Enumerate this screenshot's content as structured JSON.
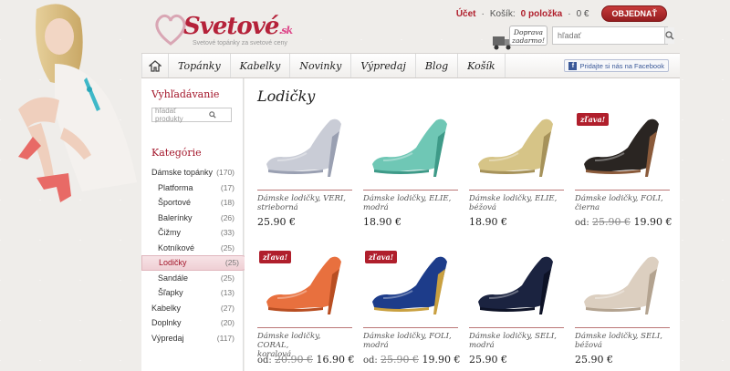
{
  "header": {
    "logo_text": "Svetové",
    "logo_suffix": ".sk",
    "tagline": "Svetové topánky za svetové ceny",
    "account_label": "Účet",
    "cart_label": "Košík:",
    "cart_count": "0 položka",
    "cart_total": "0 €",
    "order_button": "OBJEDNAŤ",
    "delivery_badge_line1": "Doprava",
    "delivery_badge_line2": "zadarmo!",
    "search_placeholder": "hľadať"
  },
  "nav": {
    "items": [
      "Topánky",
      "Kabelky",
      "Novinky",
      "Výpredaj",
      "Blog",
      "Košík"
    ],
    "facebook_label": "Pridajte si nás na Facebook"
  },
  "sidebar": {
    "search_title": "Vyhľadávanie",
    "search_placeholder": "hľadať produkty",
    "categories_title": "Kategórie",
    "categories": [
      {
        "label": "Dámske topánky",
        "count": "(170)",
        "sub": false,
        "active": false
      },
      {
        "label": "Platforma",
        "count": "(17)",
        "sub": true,
        "active": false
      },
      {
        "label": "Športové",
        "count": "(18)",
        "sub": true,
        "active": false
      },
      {
        "label": "Balerínky",
        "count": "(26)",
        "sub": true,
        "active": false
      },
      {
        "label": "Čižmy",
        "count": "(33)",
        "sub": true,
        "active": false
      },
      {
        "label": "Kotníkové",
        "count": "(25)",
        "sub": true,
        "active": false
      },
      {
        "label": "Lodičky",
        "count": "(25)",
        "sub": true,
        "active": true
      },
      {
        "label": "Sandále",
        "count": "(25)",
        "sub": true,
        "active": false
      },
      {
        "label": "Šľapky",
        "count": "(13)",
        "sub": true,
        "active": false
      },
      {
        "label": "Kabelky",
        "count": "(27)",
        "sub": false,
        "active": false
      },
      {
        "label": "Doplnky",
        "count": "(20)",
        "sub": false,
        "active": false
      },
      {
        "label": "Výpredaj",
        "count": "(117)",
        "sub": false,
        "active": false
      }
    ]
  },
  "main": {
    "title": "Lodičky",
    "sale_badge": "zľava!",
    "from_label": "od:",
    "products": [
      {
        "name_line1": "Dámske lodičky, VERI,",
        "name_line2": "strieborná",
        "price": "25.90 €",
        "old_price": "",
        "sale": false,
        "color": "#c9ccd6",
        "accent": "#9aa0b2"
      },
      {
        "name_line1": "Dámske lodičky, ELIE,",
        "name_line2": "modrá",
        "price": "18.90 €",
        "old_price": "",
        "sale": false,
        "color": "#6fc7b5",
        "accent": "#3e9a88"
      },
      {
        "name_line1": "Dámske lodičky, ELIE,",
        "name_line2": "béžová",
        "price": "18.90 €",
        "old_price": "",
        "sale": false,
        "color": "#d6c487",
        "accent": "#a6925a"
      },
      {
        "name_line1": "Dámske lodičky, FOLI,",
        "name_line2": "čierna",
        "price": "19.90 €",
        "old_price": "25.90 €",
        "sale": true,
        "color": "#2a2522",
        "accent": "#8a5a3a"
      },
      {
        "name_line1": "Dámske lodičky, CORAL,",
        "name_line2": "koralová",
        "price": "16.90 €",
        "old_price": "20.90 €",
        "sale": true,
        "color": "#e8703e",
        "accent": "#b84e22"
      },
      {
        "name_line1": "Dámske lodičky, FOLI,",
        "name_line2": "modrá",
        "price": "19.90 €",
        "old_price": "25.90 €",
        "sale": true,
        "color": "#1d3c8a",
        "accent": "#c9a040"
      },
      {
        "name_line1": "Dámske lodičky, SELI,",
        "name_line2": "modrá",
        "price": "25.90 €",
        "old_price": "",
        "sale": false,
        "color": "#1b2340",
        "accent": "#0d1226"
      },
      {
        "name_line1": "Dámske lodičky, SELI,",
        "name_line2": "béžová",
        "price": "25.90 €",
        "old_price": "",
        "sale": false,
        "color": "#dccfc0",
        "accent": "#b3a390"
      }
    ]
  }
}
